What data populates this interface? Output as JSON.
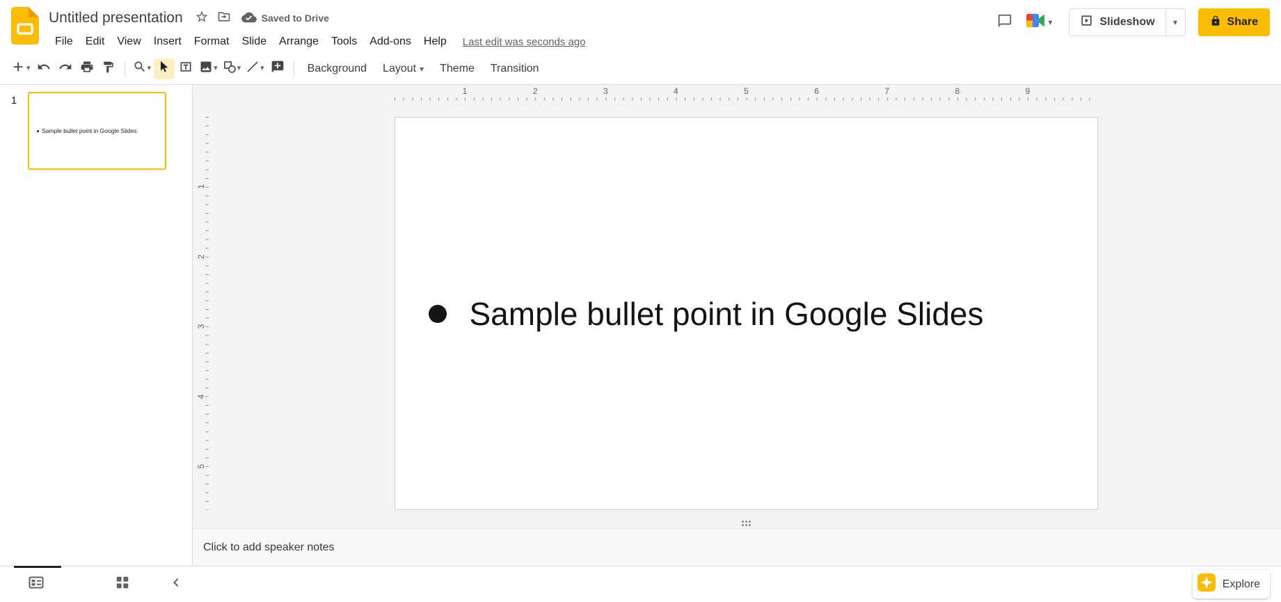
{
  "header": {
    "title": "Untitled presentation",
    "saved_status": "Saved to Drive",
    "menus": [
      "File",
      "Edit",
      "View",
      "Insert",
      "Format",
      "Slide",
      "Arrange",
      "Tools",
      "Add-ons",
      "Help"
    ],
    "last_edit": "Last edit was seconds ago",
    "slideshow_label": "Slideshow",
    "share_label": "Share"
  },
  "toolbar": {
    "background_label": "Background",
    "layout_label": "Layout",
    "theme_label": "Theme",
    "transition_label": "Transition"
  },
  "filmstrip": {
    "slide_number": "1",
    "thumb_text": "Sample bullet point in Google Slides"
  },
  "rulers": {
    "horizontal": [
      "1",
      "2",
      "3",
      "4",
      "5",
      "6",
      "7",
      "8",
      "9"
    ],
    "vertical": [
      "1",
      "2",
      "3",
      "4",
      "5"
    ]
  },
  "slide": {
    "bullet_text": "Sample bullet point in Google Slides"
  },
  "notes": {
    "placeholder": "Click to add speaker notes"
  },
  "footer": {
    "explore_label": "Explore"
  },
  "icons": {
    "caret_down": "▾"
  },
  "colors": {
    "accent_yellow": "#fbbc04",
    "selected_tool_bg": "#feefc3",
    "canvas_bg": "#f1f3f4"
  }
}
